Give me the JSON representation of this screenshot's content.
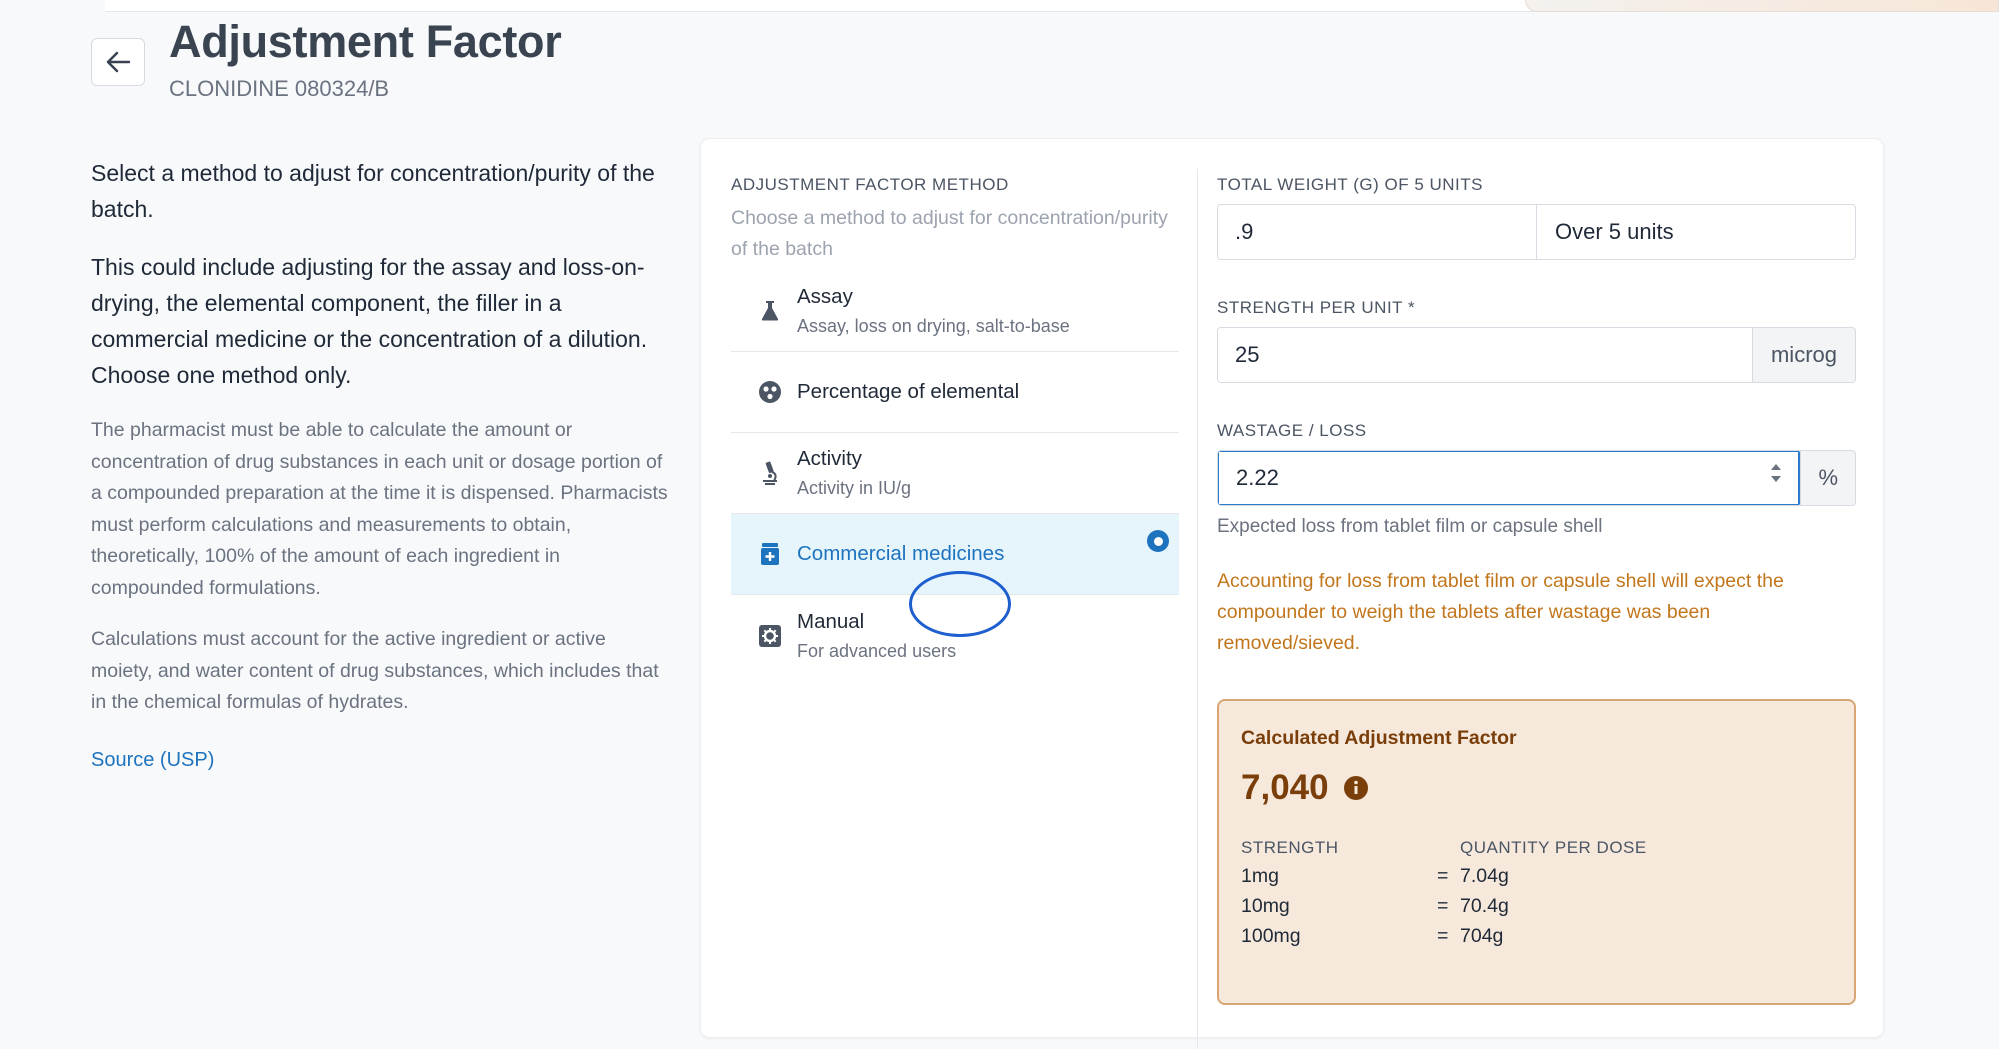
{
  "header": {
    "title": "Adjustment Factor",
    "subtitle": "CLONIDINE 080324/B"
  },
  "left": {
    "intro1": "Select a method to adjust for concentration/purity of the batch.",
    "intro2": "This could include adjusting for the assay and loss-on-drying, the elemental component, the filler in a commercial medicine or the concentration of a dilution. Choose one method only.",
    "para1": "The pharmacist must be able to calculate the amount or concentration of drug substances in each unit or dosage portion of a compounded preparation at the time it is dispensed. Pharmacists must perform calculations and measurements to obtain, theoretically, 100% of the amount of each ingredient in compounded formulations.",
    "para2": "Calculations must account for the active ingredient or active moiety, and water content of drug substances, which includes that in the chemical formulas of hydrates.",
    "source_link": "Source (USP)"
  },
  "methods": {
    "label": "ADJUSTMENT FACTOR METHOD",
    "description": "Choose a method to adjust for concentration/purity of the batch",
    "items": [
      {
        "title": "Assay",
        "subtitle": "Assay, loss on drying, salt-to-base",
        "icon": "flask-icon"
      },
      {
        "title": "Percentage of elemental",
        "subtitle": "",
        "icon": "atom-icon"
      },
      {
        "title": "Activity",
        "subtitle": "Activity in IU/g",
        "icon": "microscope-icon"
      },
      {
        "title": "Commercial medicines",
        "subtitle": "",
        "icon": "medicine-box-icon",
        "selected": true
      },
      {
        "title": "Manual",
        "subtitle": "For advanced users",
        "icon": "manual-cog-icon"
      }
    ]
  },
  "form": {
    "total_weight": {
      "label": "TOTAL WEIGHT (G) OF 5 UNITS",
      "value": ".9",
      "addon": "Over 5 units"
    },
    "strength": {
      "label": "STRENGTH PER UNIT *",
      "value": "25",
      "unit": "microg"
    },
    "wastage": {
      "label": "WASTAGE / LOSS",
      "value": "2.22",
      "unit": "%",
      "hint": "Expected loss from tablet film or capsule shell"
    },
    "warning": "Accounting for loss from tablet film or capsule shell will expect the compounder to weigh the tablets after wastage was been removed/sieved."
  },
  "result": {
    "title": "Calculated Adjustment Factor",
    "value": "7,040",
    "col_strength": "STRENGTH",
    "col_quantity": "QUANTITY PER DOSE",
    "rows": [
      {
        "strength": "1mg",
        "eq": "=",
        "quantity": "7.04g"
      },
      {
        "strength": "10mg",
        "eq": "=",
        "quantity": "70.4g"
      },
      {
        "strength": "100mg",
        "eq": "=",
        "quantity": "704g"
      }
    ]
  },
  "colors": {
    "accent": "#1e73be",
    "selected_bg": "#e6f5fc",
    "warning": "#c2761c",
    "result_bg": "#f6e9dc",
    "result_text": "#7a3e0a"
  }
}
